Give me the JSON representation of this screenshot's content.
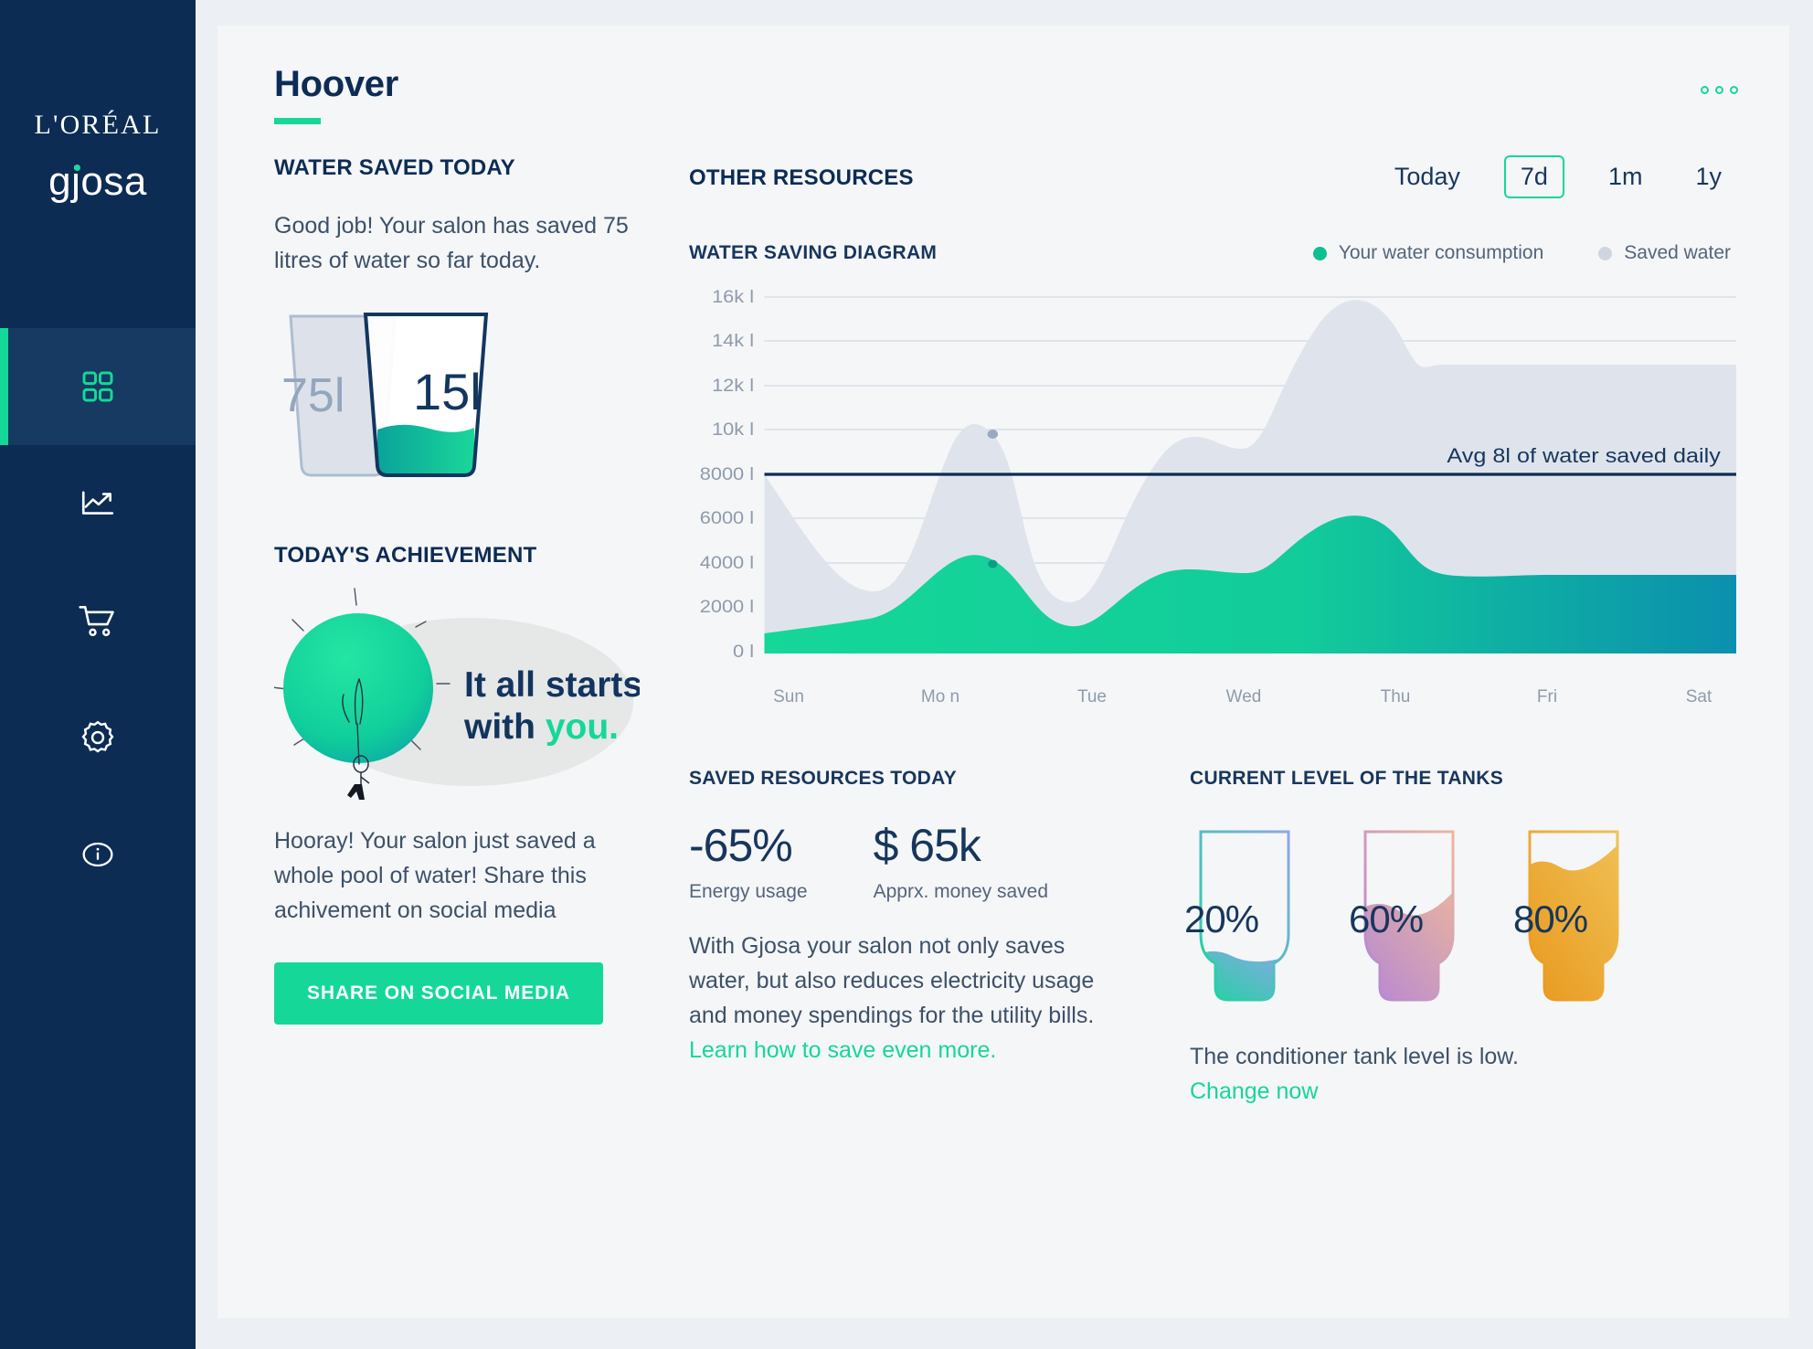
{
  "sidebar": {
    "brand_top": "L'ORÉAL",
    "brand_bottom": "gjosa",
    "items": [
      {
        "id": "dashboard",
        "icon": "grid-icon",
        "active": true
      },
      {
        "id": "analytics",
        "icon": "trend-up-icon",
        "active": false
      },
      {
        "id": "shop",
        "icon": "shopping-cart-icon",
        "active": false
      },
      {
        "id": "settings",
        "icon": "gear-icon",
        "active": false
      },
      {
        "id": "info",
        "icon": "info-circle-icon",
        "active": false
      }
    ]
  },
  "header": {
    "title": "Hoover",
    "menu_icon": "kebab-menu-icon"
  },
  "left": {
    "water_saved_title": "WATER SAVED TODAY",
    "water_saved_text": "Good job! Your salon has saved 75 litres of water so far today.",
    "glass_old_label": "75l",
    "glass_new_label": "15l",
    "achievement_title": "TODAY'S ACHIEVEMENT",
    "achievement_art_line1": "It all starts",
    "achievement_art_line2a": "with ",
    "achievement_art_line2b": "you.",
    "achievement_text": "Hooray! Your salon just saved a whole pool of water! Share this achivement on social media",
    "share_button": "SHARE ON SOCIAL MEDIA"
  },
  "resources": {
    "section_title": "OTHER RESOURCES",
    "ranges": [
      {
        "label": "Today",
        "selected": false
      },
      {
        "label": "7d",
        "selected": true
      },
      {
        "label": "1m",
        "selected": false
      },
      {
        "label": "1y",
        "selected": false
      }
    ]
  },
  "saved_today": {
    "title": "SAVED RESOURCES TODAY",
    "energy_value": "-65%",
    "energy_label": "Energy usage",
    "money_value": "$ 65k",
    "money_label": "Apprx. money saved",
    "paragraph": "With Gjosa your salon not only saves water, but also reduces electricity usage and money spendings for the utility bills.",
    "link": "Learn how to save even more."
  },
  "tanks": {
    "title": "CURRENT LEVEL OF  THE TANKS",
    "items": [
      {
        "percent": "20%",
        "fill": 0.2,
        "color_a": "#15d798",
        "color_b": "#7a9ae8"
      },
      {
        "percent": "60%",
        "fill": 0.6,
        "color_a": "#b98ad6",
        "color_b": "#e8a48c"
      },
      {
        "percent": "80%",
        "fill": 0.8,
        "color_a": "#f0a51e",
        "color_b": "#e8b84a"
      }
    ],
    "note": "The conditioner tank level is low.",
    "link": "Change now"
  },
  "colors": {
    "accent_green": "#15d798",
    "navy": "#0c2c54",
    "sidebar_bg": "#0c2c54",
    "card_bg": "#f5f6f8",
    "grey_series": "#dfe4ec"
  },
  "chart_data": {
    "type": "area",
    "title": "WATER SAVING DIAGRAM",
    "xlabel": "",
    "ylabel": "",
    "grid": true,
    "legend_position": "top-right",
    "categories": [
      "Sun",
      "Mo\nn",
      "Tue",
      "Wed",
      "Thu",
      "Fri",
      "Sat"
    ],
    "ytick_labels": [
      "16k l",
      "14k l",
      "12k l",
      "10k l",
      "8000 l",
      "6000 l",
      "4000 l",
      "2000 l",
      "0 l"
    ],
    "ytick_values": [
      16000,
      14000,
      12000,
      10000,
      8000,
      6000,
      4000,
      2000,
      0
    ],
    "ylim": [
      0,
      16500
    ],
    "series": [
      {
        "name": "Saved water",
        "color": "#dfe4ec",
        "values": [
          8000,
          3900,
          11200,
          3500,
          12200,
          16000,
          13000
        ]
      },
      {
        "name": "Your water consumption",
        "color": "#15d798",
        "values": [
          900,
          1100,
          3800,
          1500,
          4700,
          6200,
          4800
        ]
      }
    ],
    "annotation": {
      "label": "Avg 8l of water saved daily",
      "value": 8000,
      "line_color": "#0c2c54"
    },
    "markers": [
      {
        "series": "Saved water",
        "x": "Tue",
        "y": 11200
      },
      {
        "series": "Your water consumption",
        "x": "Tue",
        "y": 3800
      }
    ]
  }
}
